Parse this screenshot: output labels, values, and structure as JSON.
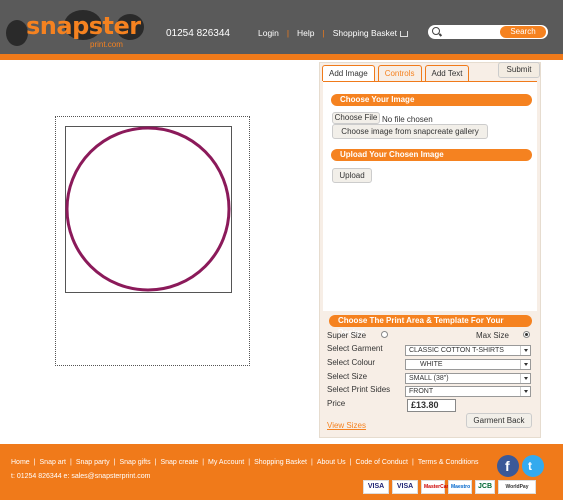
{
  "header": {
    "logo_text": "snapster",
    "logo_sub": "print.com",
    "phone": "01254 826344",
    "nav": [
      "Login",
      "Help",
      "Shopping Basket"
    ],
    "search_button": "Search",
    "search_placeholder": ""
  },
  "tabs": [
    "Add Image",
    "Controls",
    "Add Text"
  ],
  "submit_label": "Submit",
  "image_section": {
    "heading": "Choose Your Image",
    "choose_file": "Choose File",
    "no_file": "No file chosen",
    "gallery_button": "Choose image from snapcreate gallery",
    "upload_heading": "Upload Your Chosen Image",
    "upload_button": "Upload"
  },
  "print_section": {
    "heading": "Choose The Print Area & Template For Your Design",
    "super_size": "Super Size",
    "max_size": "Max Size",
    "selected_size": "Max Size",
    "garment_label": "Select Garment",
    "garment_value": "CLASSIC COTTON T-SHIRTS",
    "colour_label": "Select Colour",
    "colour_value": "WHITE",
    "size_label": "Select Size",
    "size_value": "SMALL (38\")",
    "sides_label": "Select Print Sides",
    "sides_value": "FRONT",
    "price_label": "Price",
    "price_value": "£13.80",
    "view_sizes": "View Sizes",
    "back_button": "Garment Back"
  },
  "design": {
    "circle_color": "#8b1a5a"
  },
  "footer": {
    "links": [
      "Home",
      "Snap art",
      "Snap party",
      "Snap gifts",
      "Snap create",
      "My Account",
      "Shopping Basket",
      "About Us",
      "Code of Conduct",
      "Terms & Conditions"
    ],
    "contact": "t: 01254 826344 e: sales@snapsterprint.com",
    "cards": [
      "VISA",
      "VISA",
      "MasterCard",
      "Maestro",
      "JCB",
      "WorldPay"
    ]
  },
  "colors": {
    "brand_orange": "#f58220",
    "header_grey": "#5a5a5a"
  }
}
